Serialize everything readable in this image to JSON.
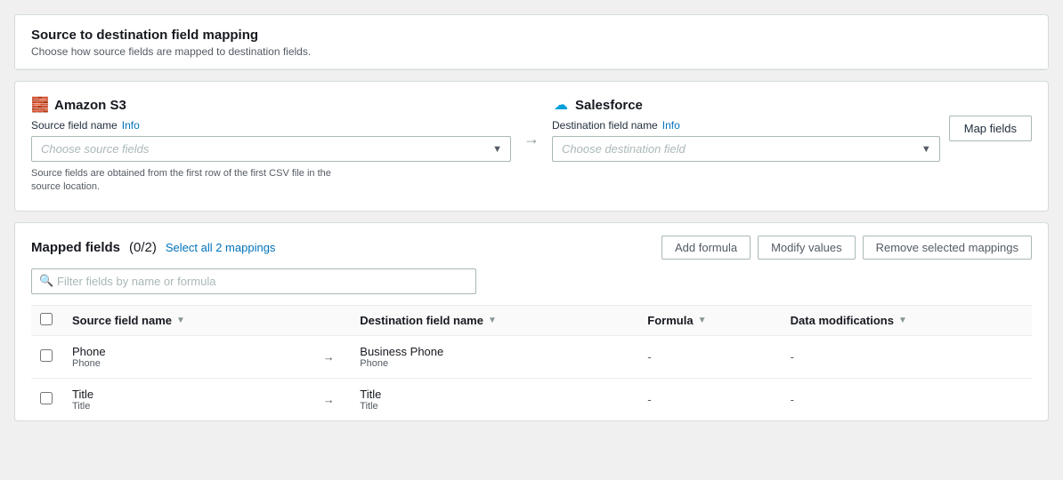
{
  "page": {
    "title": "Source to destination field mapping",
    "subtitle": "Choose how source fields are mapped to destination fields."
  },
  "source": {
    "service_name": "Amazon S3",
    "service_icon": "🧱",
    "field_label": "Source field name",
    "info_text": "Info",
    "placeholder": "Choose source fields",
    "hint": "Source fields are obtained from the first row of the first CSV file in the source location."
  },
  "destination": {
    "service_name": "Salesforce",
    "service_icon": "☁",
    "field_label": "Destination field name",
    "info_text": "Info",
    "placeholder": "Choose destination field"
  },
  "map_fields_btn": "Map fields",
  "mapped": {
    "title": "Mapped fields",
    "count": "(0/2)",
    "select_all_link": "Select all 2 mappings",
    "filter_placeholder": "Filter fields by name or formula",
    "add_formula_btn": "Add formula",
    "modify_values_btn": "Modify values",
    "remove_btn": "Remove selected mappings",
    "columns": [
      {
        "label": "Source field name",
        "key": "source_name"
      },
      {
        "label": "Destination field name",
        "key": "dest_name"
      },
      {
        "label": "Formula",
        "key": "formula"
      },
      {
        "label": "Data modifications",
        "key": "data_mods"
      }
    ],
    "rows": [
      {
        "source_main": "Phone",
        "source_sub": "Phone",
        "dest_main": "Business Phone",
        "dest_sub": "Phone",
        "formula": "-",
        "data_mods": "-"
      },
      {
        "source_main": "Title",
        "source_sub": "Title",
        "dest_main": "Title",
        "dest_sub": "Title",
        "formula": "-",
        "data_mods": "-"
      }
    ]
  }
}
